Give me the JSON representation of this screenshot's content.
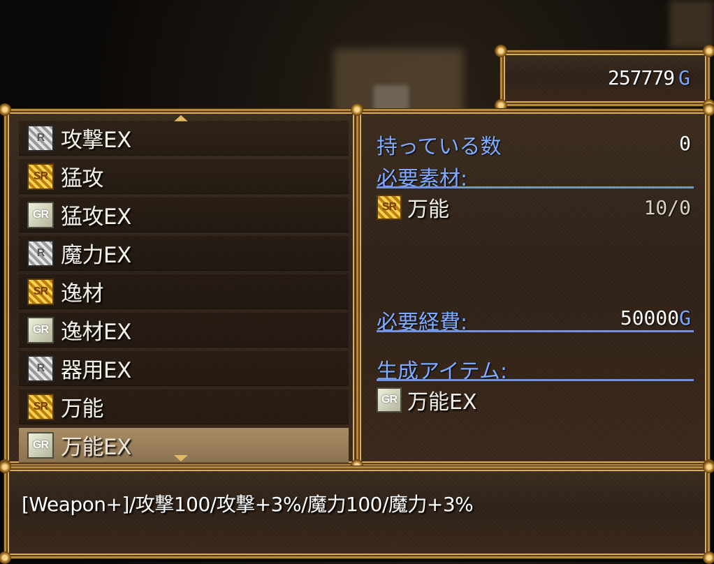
{
  "gold": {
    "amount": "257779",
    "unit": "G"
  },
  "item_list": [
    {
      "rank": "R",
      "name": "攻撃EX"
    },
    {
      "rank": "SR",
      "name": "猛攻"
    },
    {
      "rank": "GR",
      "name": "猛攻EX"
    },
    {
      "rank": "R",
      "name": "魔力EX"
    },
    {
      "rank": "SR",
      "name": "逸材"
    },
    {
      "rank": "GR",
      "name": "逸材EX"
    },
    {
      "rank": "R",
      "name": "器用EX"
    },
    {
      "rank": "SR",
      "name": "万能"
    },
    {
      "rank": "GR",
      "name": "万能EX"
    }
  ],
  "selected_index": 8,
  "detail": {
    "owned_label": "持っている数",
    "owned_value": "0",
    "materials_label": "必要素材:",
    "materials": [
      {
        "rank": "SR",
        "name": "万能",
        "count": "10/0"
      }
    ],
    "cost_label": "必要経費:",
    "cost_value": "50000",
    "cost_unit": "G",
    "result_label": "生成アイテム:",
    "result": {
      "rank": "GR",
      "name": "万能EX"
    }
  },
  "help": {
    "text": "[Weapon+]/攻撃100/攻撃+3%/魔力100/魔力+3%"
  },
  "colors": {
    "frame_gold": "#b8893b",
    "label_blue": "#7eaaff",
    "selected_row": "#a88c66"
  }
}
